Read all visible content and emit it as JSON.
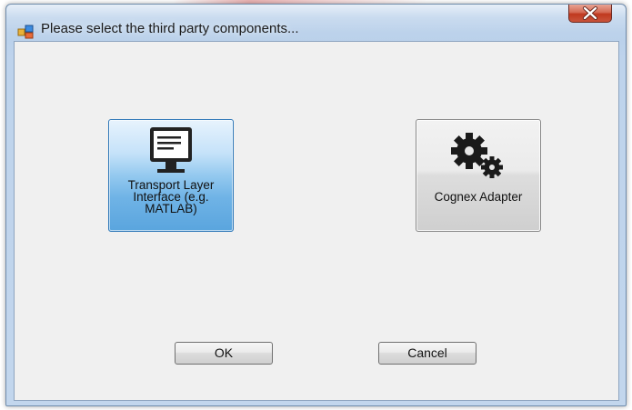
{
  "window": {
    "title": "Please select the third party components..."
  },
  "icons": {
    "app": "app-window-icon",
    "close": "close-x-icon",
    "transport": "monitor-icon",
    "cognex": "gears-icon"
  },
  "options": [
    {
      "id": "transport-layer",
      "label_lines": [
        "Transport Layer",
        "Interface  (e.g.",
        "MATLAB)"
      ],
      "selected": true
    },
    {
      "id": "cognex-adapter",
      "label_lines": [
        "Cognex Adapter"
      ],
      "selected": false
    }
  ],
  "buttons": {
    "ok": "OK",
    "cancel": "Cancel"
  },
  "colors": {
    "selected_tile": "#6fb3e6",
    "close_button": "#c9543c",
    "window_frame": "#b9d0ea"
  }
}
